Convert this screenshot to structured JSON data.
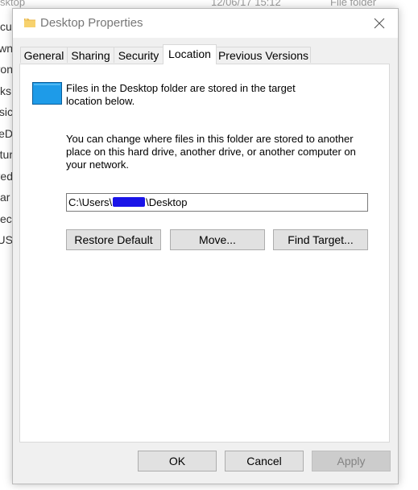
{
  "background_window": {
    "header_left": "sktop",
    "header_date": "12/06/17 15:12",
    "header_type": "File folder",
    "left_items": [
      "cu",
      "wn",
      "ron",
      "ks",
      "sic",
      "eD",
      "tur",
      "ved",
      "ar",
      "ec",
      "US"
    ]
  },
  "dialog": {
    "title": "Desktop Properties",
    "tabs": [
      {
        "label": "General"
      },
      {
        "label": "Sharing"
      },
      {
        "label": "Security"
      },
      {
        "label": "Location"
      },
      {
        "label": "Previous Versions"
      }
    ],
    "active_tab": "Location",
    "info_text": "Files in the Desktop folder are stored in the target location below.",
    "description": "You can change where files in this folder are stored to another place on this hard drive, another drive, or another computer on your network.",
    "path_prefix": "C:\\Users\\",
    "path_suffix": "\\Desktop",
    "buttons": {
      "restore_default": "Restore Default",
      "move": "Move...",
      "find_target": "Find Target..."
    },
    "footer": {
      "ok": "OK",
      "cancel": "Cancel",
      "apply": "Apply"
    }
  },
  "colors": {
    "dialog_bg": "#f0f0f0",
    "panel_bg": "#ffffff",
    "button_bg": "#e1e1e1",
    "redaction": "#1a14e8",
    "folder_icon": "#1e9be8"
  }
}
